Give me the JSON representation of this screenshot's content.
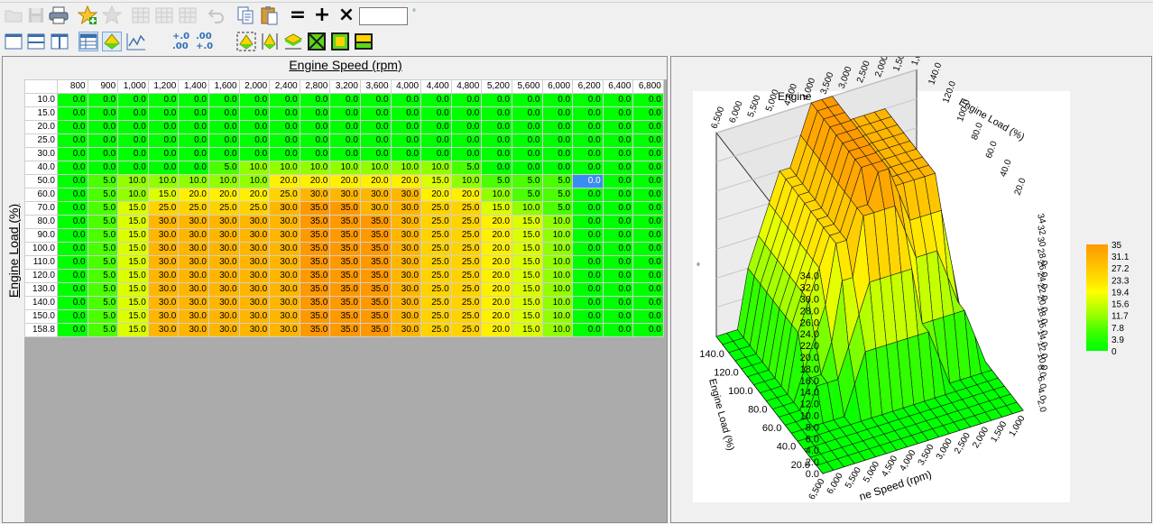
{
  "toolbar1": {
    "value_input": "",
    "unit_symbol": "°",
    "equals": "=",
    "plus": "+",
    "times": "×"
  },
  "toolbar2": {
    "dec_increase_top": "+.0",
    "dec_increase_bottom": ".00",
    "dec_decrease_top": ".00",
    "dec_decrease_bottom": "+.0"
  },
  "table": {
    "x_axis_title": "Engine Speed (rpm)",
    "y_axis_title": "Engine Load (%)",
    "columns": [
      "800",
      "900",
      "1,000",
      "1,200",
      "1,400",
      "1,600",
      "2,000",
      "2,400",
      "2,800",
      "3,200",
      "3,600",
      "4,000",
      "4,400",
      "4,800",
      "5,200",
      "5,600",
      "6,000",
      "6,200",
      "6,400",
      "6,800"
    ],
    "rows": [
      {
        "load": "10.0",
        "values": [
          "0.0",
          "0.0",
          "0.0",
          "0.0",
          "0.0",
          "0.0",
          "0.0",
          "0.0",
          "0.0",
          "0.0",
          "0.0",
          "0.0",
          "0.0",
          "0.0",
          "0.0",
          "0.0",
          "0.0",
          "0.0",
          "0.0",
          "0.0"
        ]
      },
      {
        "load": "15.0",
        "values": [
          "0.0",
          "0.0",
          "0.0",
          "0.0",
          "0.0",
          "0.0",
          "0.0",
          "0.0",
          "0.0",
          "0.0",
          "0.0",
          "0.0",
          "0.0",
          "0.0",
          "0.0",
          "0.0",
          "0.0",
          "0.0",
          "0.0",
          "0.0"
        ]
      },
      {
        "load": "20.0",
        "values": [
          "0.0",
          "0.0",
          "0.0",
          "0.0",
          "0.0",
          "0.0",
          "0.0",
          "0.0",
          "0.0",
          "0.0",
          "0.0",
          "0.0",
          "0.0",
          "0.0",
          "0.0",
          "0.0",
          "0.0",
          "0.0",
          "0.0",
          "0.0"
        ]
      },
      {
        "load": "25.0",
        "values": [
          "0.0",
          "0.0",
          "0.0",
          "0.0",
          "0.0",
          "0.0",
          "0.0",
          "0.0",
          "0.0",
          "0.0",
          "0.0",
          "0.0",
          "0.0",
          "0.0",
          "0.0",
          "0.0",
          "0.0",
          "0.0",
          "0.0",
          "0.0"
        ]
      },
      {
        "load": "30.0",
        "values": [
          "0.0",
          "0.0",
          "0.0",
          "0.0",
          "0.0",
          "0.0",
          "0.0",
          "0.0",
          "0.0",
          "0.0",
          "0.0",
          "0.0",
          "0.0",
          "0.0",
          "0.0",
          "0.0",
          "0.0",
          "0.0",
          "0.0",
          "0.0"
        ]
      },
      {
        "load": "40.0",
        "values": [
          "0.0",
          "0.0",
          "0.0",
          "0.0",
          "0.0",
          "5.0",
          "10.0",
          "10.0",
          "10.0",
          "10.0",
          "10.0",
          "10.0",
          "10.0",
          "5.0",
          "0.0",
          "0.0",
          "0.0",
          "0.0",
          "0.0",
          "0.0"
        ]
      },
      {
        "load": "50.0",
        "values": [
          "0.0",
          "5.0",
          "10.0",
          "10.0",
          "10.0",
          "10.0",
          "10.0",
          "20.0",
          "20.0",
          "20.0",
          "20.0",
          "20.0",
          "15.0",
          "10.0",
          "5.0",
          "5.0",
          "5.0",
          "0.0",
          "0.0",
          "0.0"
        ]
      },
      {
        "load": "60.0",
        "values": [
          "0.0",
          "5.0",
          "10.0",
          "15.0",
          "20.0",
          "20.0",
          "20.0",
          "25.0",
          "30.0",
          "30.0",
          "30.0",
          "30.0",
          "20.0",
          "20.0",
          "10.0",
          "5.0",
          "5.0",
          "0.0",
          "0.0",
          "0.0"
        ]
      },
      {
        "load": "70.0",
        "values": [
          "0.0",
          "5.0",
          "15.0",
          "25.0",
          "25.0",
          "25.0",
          "25.0",
          "30.0",
          "35.0",
          "35.0",
          "30.0",
          "30.0",
          "25.0",
          "25.0",
          "15.0",
          "10.0",
          "5.0",
          "0.0",
          "0.0",
          "0.0"
        ]
      },
      {
        "load": "80.0",
        "values": [
          "0.0",
          "5.0",
          "15.0",
          "30.0",
          "30.0",
          "30.0",
          "30.0",
          "30.0",
          "35.0",
          "35.0",
          "35.0",
          "30.0",
          "25.0",
          "25.0",
          "20.0",
          "15.0",
          "10.0",
          "0.0",
          "0.0",
          "0.0"
        ]
      },
      {
        "load": "90.0",
        "values": [
          "0.0",
          "5.0",
          "15.0",
          "30.0",
          "30.0",
          "30.0",
          "30.0",
          "30.0",
          "35.0",
          "35.0",
          "35.0",
          "30.0",
          "25.0",
          "25.0",
          "20.0",
          "15.0",
          "10.0",
          "0.0",
          "0.0",
          "0.0"
        ]
      },
      {
        "load": "100.0",
        "values": [
          "0.0",
          "5.0",
          "15.0",
          "30.0",
          "30.0",
          "30.0",
          "30.0",
          "30.0",
          "35.0",
          "35.0",
          "35.0",
          "30.0",
          "25.0",
          "25.0",
          "20.0",
          "15.0",
          "10.0",
          "0.0",
          "0.0",
          "0.0"
        ]
      },
      {
        "load": "110.0",
        "values": [
          "0.0",
          "5.0",
          "15.0",
          "30.0",
          "30.0",
          "30.0",
          "30.0",
          "30.0",
          "35.0",
          "35.0",
          "35.0",
          "30.0",
          "25.0",
          "25.0",
          "20.0",
          "15.0",
          "10.0",
          "0.0",
          "0.0",
          "0.0"
        ]
      },
      {
        "load": "120.0",
        "values": [
          "0.0",
          "5.0",
          "15.0",
          "30.0",
          "30.0",
          "30.0",
          "30.0",
          "30.0",
          "35.0",
          "35.0",
          "35.0",
          "30.0",
          "25.0",
          "25.0",
          "20.0",
          "15.0",
          "10.0",
          "0.0",
          "0.0",
          "0.0"
        ]
      },
      {
        "load": "130.0",
        "values": [
          "0.0",
          "5.0",
          "15.0",
          "30.0",
          "30.0",
          "30.0",
          "30.0",
          "30.0",
          "35.0",
          "35.0",
          "35.0",
          "30.0",
          "25.0",
          "25.0",
          "20.0",
          "15.0",
          "10.0",
          "0.0",
          "0.0",
          "0.0"
        ]
      },
      {
        "load": "140.0",
        "values": [
          "0.0",
          "5.0",
          "15.0",
          "30.0",
          "30.0",
          "30.0",
          "30.0",
          "30.0",
          "35.0",
          "35.0",
          "35.0",
          "30.0",
          "25.0",
          "25.0",
          "20.0",
          "15.0",
          "10.0",
          "0.0",
          "0.0",
          "0.0"
        ]
      },
      {
        "load": "150.0",
        "values": [
          "0.0",
          "5.0",
          "15.0",
          "30.0",
          "30.0",
          "30.0",
          "30.0",
          "30.0",
          "35.0",
          "35.0",
          "35.0",
          "30.0",
          "25.0",
          "25.0",
          "20.0",
          "15.0",
          "10.0",
          "0.0",
          "0.0",
          "0.0"
        ]
      },
      {
        "load": "158.8",
        "values": [
          "0.0",
          "5.0",
          "15.0",
          "30.0",
          "30.0",
          "30.0",
          "30.0",
          "30.0",
          "35.0",
          "35.0",
          "35.0",
          "30.0",
          "25.0",
          "25.0",
          "20.0",
          "15.0",
          "10.0",
          "0.0",
          "0.0",
          "0.0"
        ]
      }
    ],
    "selected_cell": {
      "row": 6,
      "col": 17
    },
    "color_scale": [
      "#00ff00",
      "#ffff00",
      "#ff9900"
    ]
  },
  "chart_data": {
    "type": "surface3d",
    "title": "",
    "x_label": "Engine Speed (rpm)",
    "y_label": "Engine Load (%)",
    "z_ticks": [
      "0.0",
      "2.0",
      "4.0",
      "6.0",
      "8.0",
      "10.0",
      "12.0",
      "14.0",
      "16.0",
      "18.0",
      "20.0",
      "22.0",
      "24.0",
      "26.0",
      "28.0",
      "30.0",
      "32.0",
      "34.0"
    ],
    "speed_ticks_top": [
      "6,500",
      "6,000",
      "5,500",
      "5,000",
      "4,500",
      "4,000",
      "3,500",
      "3,000",
      "2,500",
      "2,000",
      "1,500",
      "1,000"
    ],
    "speed_ticks_bottom": [
      "6,500",
      "6,000",
      "5,500",
      "5,000",
      "4,500",
      "4,000",
      "3,500",
      "3,000",
      "2,500",
      "2,000",
      "1,500",
      "1,000"
    ],
    "load_ticks_left": [
      "20.0",
      "40.0",
      "60.0",
      "80.0",
      "100.0",
      "120.0",
      "140.0"
    ],
    "load_ticks_top": [
      "140.0",
      "120.0",
      "100.0",
      "80.0",
      "60.0",
      "40.0",
      "20.0"
    ],
    "right_z_ticks": [
      "0.0",
      "2.0",
      "4.0",
      "6.0",
      "8.0",
      "10.0",
      "12.0",
      "14.0",
      "16.0",
      "18.0",
      "20.0",
      "22.0",
      "24.0",
      "26.0",
      "28.0",
      "30.0",
      "32.0",
      "34.0"
    ],
    "right_z_ticks_visible": [
      "2.0",
      "4.0",
      "6.0",
      "8.0",
      "10.0",
      "12.0",
      "14.0",
      "16.0",
      "18.0",
      "20.0",
      "22.0",
      "24.0",
      "26.0",
      "28.0",
      "30",
      "32",
      "34"
    ],
    "top_left_title_fragment": "Engine",
    "top_right_title": "Engine Load (%)",
    "bottom_title_fragment": "ne Speed (rpm)",
    "left_axis_title": "Engine Load (%)",
    "small_label": "°",
    "legend": [
      "35",
      "31.1",
      "27.2",
      "23.3",
      "19.4",
      "15.6",
      "11.7",
      "7.8",
      "3.9",
      "0"
    ],
    "legend_colors": [
      "#ff9a00",
      "#ffae00",
      "#ffc800",
      "#ffe000",
      "#ffff00",
      "#ccff00",
      "#99ff00",
      "#55ff00",
      "#22ff00",
      "#00ff00"
    ]
  }
}
